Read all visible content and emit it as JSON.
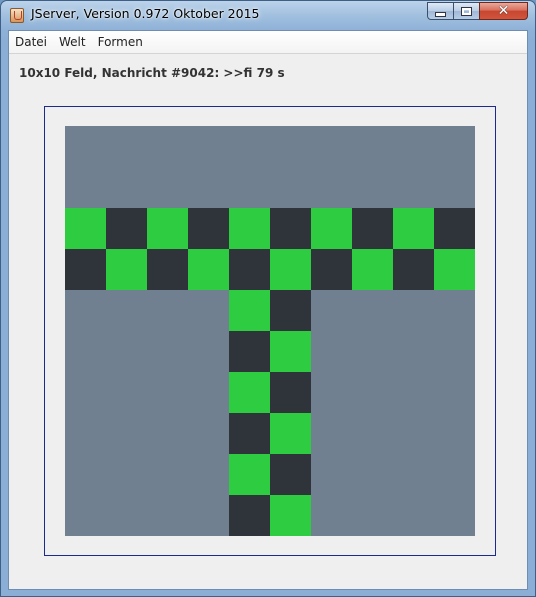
{
  "window": {
    "title": "JServer, Version 0.972 Oktober 2015",
    "close_glyph": "✕"
  },
  "menu": {
    "items": [
      "Datei",
      "Welt",
      "Formen"
    ]
  },
  "status": {
    "text": "10x10 Feld, Nachricht #9042: >>fi 79 s"
  },
  "board": {
    "rows": 10,
    "cols": 10,
    "background_color": "#708090",
    "colors": {
      "G": "#2ecc40",
      "D": "#2f343b"
    },
    "grid": [
      "..........",
      "..........",
      "GDGDGDGDGD",
      "DGDGDGDGDG",
      "....GD....",
      "....DG....",
      "....GD....",
      "....DG....",
      "....GD....",
      "....DG...."
    ]
  }
}
